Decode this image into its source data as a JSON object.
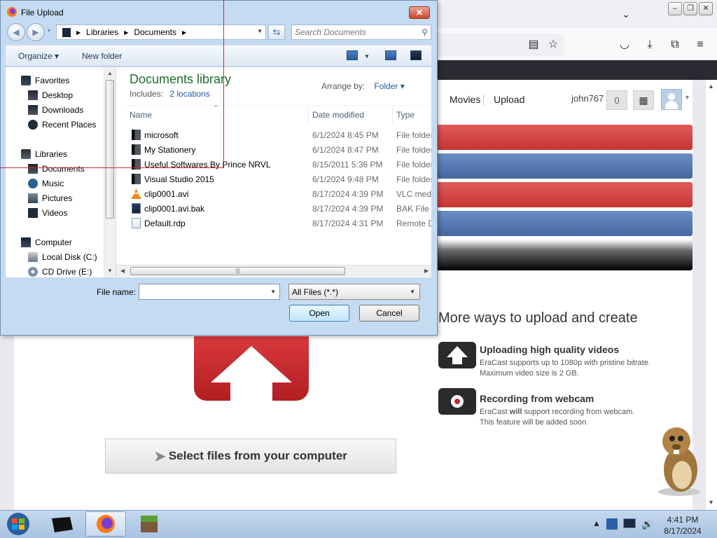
{
  "browser": {
    "site_nav": [
      "Movies",
      "Upload"
    ],
    "username": "john767",
    "notification_count": "0",
    "icons": [
      "chevron-down-icon",
      "reader-view-icon",
      "bookmark-star-icon",
      "pocket-icon",
      "download-icon",
      "extensions-icon",
      "menu-icon"
    ]
  },
  "page": {
    "more_ways_title": "More ways to upload and create",
    "features": [
      {
        "title": "Uploading high quality videos",
        "line1": "EraCast supports up to 1080p with pristine bitrate.",
        "line2": "Maximum video size is 2 GB."
      },
      {
        "title": "Recording from webcam",
        "line1_pre": "EraCast ",
        "line1_bold": "will",
        "line1_post": " support recording from webcam.",
        "line2": "This feature will be added soon."
      }
    ],
    "select_files_label": "Select files from your computer",
    "colors": {
      "red_bar": "#d24848",
      "blue_bar": "#5b7fb8",
      "upload_red": "#c42a2d"
    }
  },
  "dialog": {
    "title": "File Upload",
    "close_label": "✕",
    "address": {
      "crumbs": [
        "Libraries",
        "Documents"
      ]
    },
    "search_placeholder": "Search Documents",
    "toolbar": {
      "organize": "Organize ▾",
      "new_folder": "New folder"
    },
    "nav": {
      "favorites": "Favorites",
      "desktop": "Desktop",
      "downloads": "Downloads",
      "recent_places": "Recent Places",
      "libraries": "Libraries",
      "documents": "Documents",
      "music": "Music",
      "pictures": "Pictures",
      "videos": "Videos",
      "computer": "Computer",
      "local_disk": "Local Disk (C:)",
      "cd_drive": "CD Drive (E:)"
    },
    "library": {
      "title": "Documents library",
      "includes_label": "Includes:",
      "includes_link": "2 locations",
      "arrange_by_label": "Arrange by:",
      "arrange_by_value": "Folder ▾"
    },
    "columns": {
      "name": "Name",
      "date": "Date modified",
      "type": "Type"
    },
    "files": [
      {
        "name": "microsoft",
        "date": "6/1/2024 8:45 PM",
        "type": "File folder",
        "icon": "folder-icon"
      },
      {
        "name": "My Stationery",
        "date": "6/1/2024 8:47 PM",
        "type": "File folder",
        "icon": "folder-icon"
      },
      {
        "name": "Useful Softwares By Prince NRVL",
        "date": "8/15/2011 5:36 PM",
        "type": "File folder",
        "icon": "folder-icon"
      },
      {
        "name": "Visual Studio 2015",
        "date": "6/1/2024 9:48 PM",
        "type": "File folder",
        "icon": "folder-icon"
      },
      {
        "name": "clip0001.avi",
        "date": "8/17/2024 4:39 PM",
        "type": "VLC media file",
        "icon": "vlc-icon"
      },
      {
        "name": "clip0001.avi.bak",
        "date": "8/17/2024 4:39 PM",
        "type": "BAK File",
        "icon": "bak-file-icon"
      },
      {
        "name": "Default.rdp",
        "date": "8/17/2024 4:31 PM",
        "type": "Remote Desktop Connection",
        "icon": "rdp-file-icon"
      }
    ],
    "file_name_label": "File name:",
    "file_name_value": "",
    "filter_value": "All Files (*.*)",
    "open_label": "Open",
    "cancel_label": "Cancel"
  },
  "taskbar": {
    "time": "4:41 PM",
    "date": "8/17/2024",
    "tray_up": "▲"
  }
}
